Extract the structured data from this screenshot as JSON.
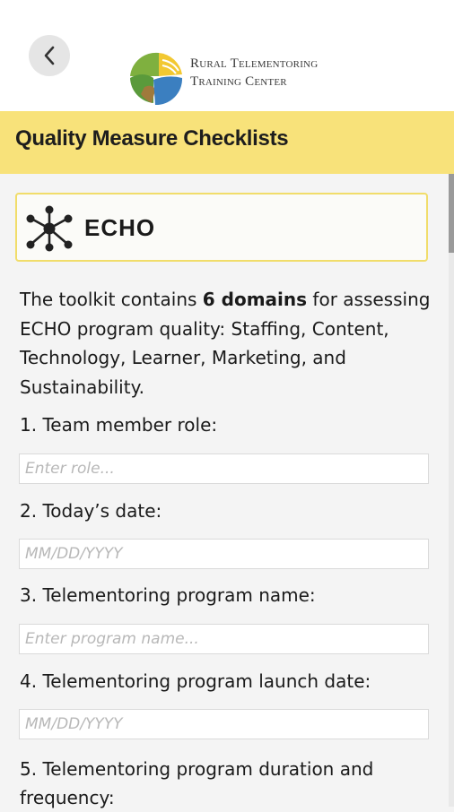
{
  "header": {
    "back_icon": "chevron-left-icon",
    "logo": {
      "line1": "Rural Telementoring",
      "line2": "Training Center"
    }
  },
  "page": {
    "title": "Quality Measure Checklists"
  },
  "card": {
    "icon": "network-hub-icon",
    "label": "ECHO"
  },
  "intro": {
    "prefix": "The toolkit contains ",
    "emphasis": "6 domains",
    "suffix": " for assessing ECHO program quality: Staffing, Content, Technology, Learner, Marketing, and Sustainability."
  },
  "form": {
    "questions": [
      {
        "label": "1. Team member role:",
        "placeholder": "Enter role..."
      },
      {
        "label": "2. Today’s date:",
        "placeholder": "MM/DD/YYYY"
      },
      {
        "label": "3. Telementoring program name:",
        "placeholder": "Enter program name..."
      },
      {
        "label": "4. Telementoring program launch date:",
        "placeholder": "MM/DD/YYYY"
      },
      {
        "label": "5. Telementoring program duration and frequency:"
      }
    ]
  },
  "colors": {
    "title_bar": "#f8e27a",
    "card_border": "#f1dd6a",
    "background": "#f4f4f4"
  }
}
